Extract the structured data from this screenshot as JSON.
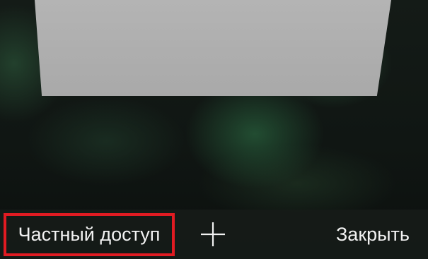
{
  "toolbar": {
    "private_label": "Частный доступ",
    "add_icon": "plus-icon",
    "close_label": "Закрыть"
  },
  "colors": {
    "highlight_border": "#e11b22",
    "toolbar_text": "#f2f2f2",
    "tab_preview": "#b0b0b0"
  }
}
